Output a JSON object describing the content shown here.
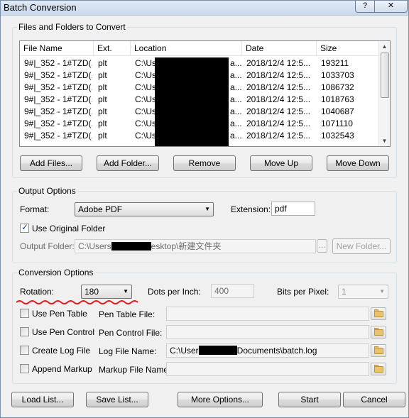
{
  "window": {
    "title": "Batch Conversion",
    "help_glyph": "?",
    "close_glyph": "✕"
  },
  "files_group": {
    "label": "Files and Folders to Convert",
    "columns": [
      "File Name",
      "Ext.",
      "Location",
      "Date",
      "Size"
    ],
    "rows": [
      {
        "name": "9#|_352 - 1#TZD(...",
        "ext": "plt",
        "location": "C:\\Us",
        "location_tail": "a...",
        "date": "2018/12/4  12:5...",
        "size": "193211"
      },
      {
        "name": "9#|_352 - 1#TZD(...",
        "ext": "plt",
        "location": "C:\\Us",
        "location_tail": "a...",
        "date": "2018/12/4  12:5...",
        "size": "1033703"
      },
      {
        "name": "9#|_352 - 1#TZD(...",
        "ext": "plt",
        "location": "C:\\Us",
        "location_tail": "a...",
        "date": "2018/12/4  12:5...",
        "size": "1086732"
      },
      {
        "name": "9#|_352 - 1#TZD(...",
        "ext": "plt",
        "location": "C:\\Us",
        "location_tail": "a...",
        "date": "2018/12/4  12:5...",
        "size": "1018763"
      },
      {
        "name": "9#|_352 - 1#TZD(...",
        "ext": "plt",
        "location": "C:\\Us",
        "location_tail": "a...",
        "date": "2018/12/4  12:5...",
        "size": "1040687"
      },
      {
        "name": "9#|_352 - 1#TZD(...",
        "ext": "plt",
        "location": "C:\\Us",
        "location_tail": "a...",
        "date": "2018/12/4  12:5...",
        "size": "1071110"
      },
      {
        "name": "9#|_352 - 1#TZD(...",
        "ext": "plt",
        "location": "C:\\Us",
        "location_tail": "a...",
        "date": "2018/12/4  12:5...",
        "size": "1032543"
      }
    ],
    "buttons": {
      "add_files": "Add Files...",
      "add_folder": "Add Folder...",
      "remove": "Remove",
      "move_up": "Move Up",
      "move_down": "Move Down"
    }
  },
  "output_group": {
    "label": "Output Options",
    "format_label": "Format:",
    "format_value": "Adobe PDF",
    "extension_label": "Extension:",
    "extension_value": "pdf",
    "use_original_folder_label": "Use Original Folder",
    "use_original_folder_checked": true,
    "output_folder_label": "Output Folder:",
    "output_folder_prefix": "C:\\Users",
    "output_folder_suffix": "esktop\\新建文件夹",
    "browse_label": "...",
    "new_folder_label": "New Folder..."
  },
  "conversion_group": {
    "label": "Conversion Options",
    "rotation_label": "Rotation:",
    "rotation_value": "180",
    "dpi_label": "Dots per Inch:",
    "dpi_value": "400",
    "bpp_label": "Bits per Pixel:",
    "bpp_value": "1",
    "use_pen_table_label": "Use Pen Table",
    "pen_table_file_label": "Pen Table File:",
    "use_pen_control_label": "Use Pen Control",
    "pen_control_file_label": "Pen Control File:",
    "create_log_label": "Create Log File",
    "log_file_label": "Log File Name:",
    "log_file_prefix": "C:\\User",
    "log_file_suffix": "Documents\\batch.log",
    "append_markup_label": "Append Markup",
    "markup_file_label": "Markup File Name:",
    "annotation_color": "#e02020"
  },
  "footer": {
    "load_list": "Load List...",
    "save_list": "Save List...",
    "more_options": "More Options...",
    "start": "Start",
    "cancel": "Cancel"
  },
  "icons": {
    "folder": "folder-icon",
    "dropdown": "chevron-down-icon",
    "scroll_up": "scroll-up-arrow-icon",
    "scroll_down": "scroll-down-arrow-icon",
    "checkmark": "checkmark-icon"
  }
}
